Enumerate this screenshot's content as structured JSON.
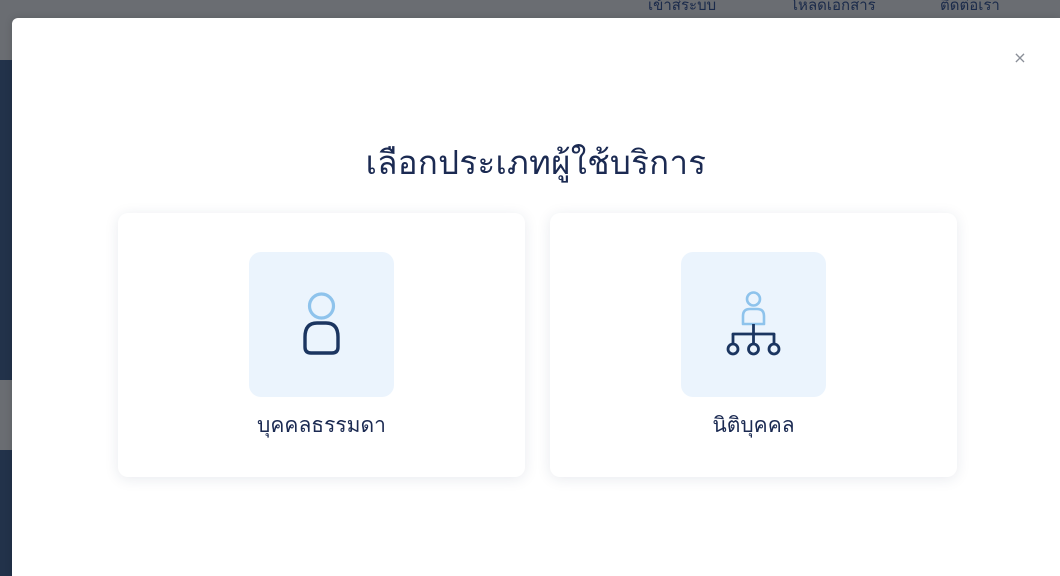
{
  "background": {
    "nav_items": [
      "เข้าสู่ระบบ",
      "โหลดเอกสาร",
      "ติดต่อเรา"
    ]
  },
  "modal": {
    "close_label": "×",
    "title": "เลือกประเภทผู้ใช้บริการ",
    "options": [
      {
        "label": "บุคคลธรรมดา",
        "icon": "person-icon"
      },
      {
        "label": "นิติบุคคล",
        "icon": "organization-icon"
      }
    ]
  },
  "colors": {
    "title": "#1b2a52",
    "icon_dark": "#1b3560",
    "icon_light": "#8ec3ec",
    "tile_bg": "#ebf4fd"
  }
}
